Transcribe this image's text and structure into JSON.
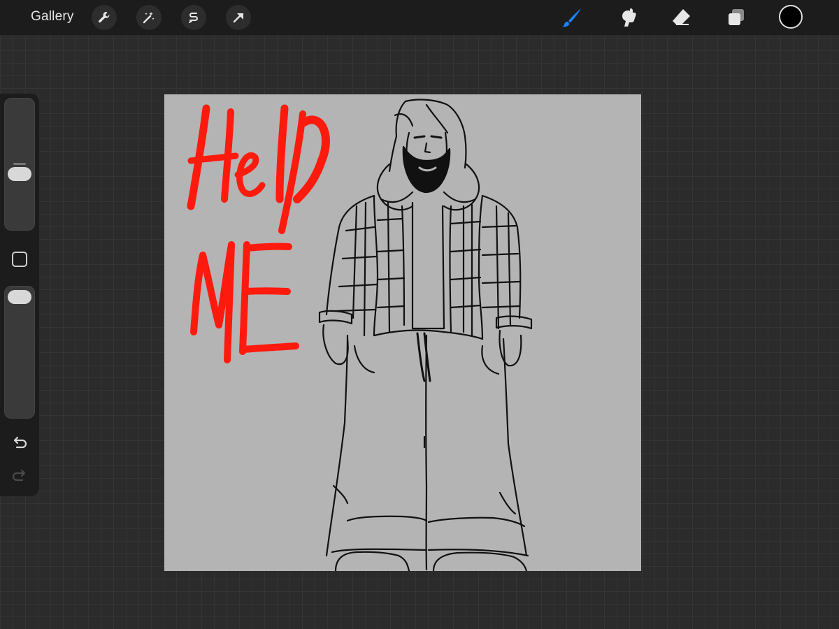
{
  "toolbar": {
    "gallery_label": "Gallery",
    "actions": [
      {
        "name": "actions-wrench-icon"
      },
      {
        "name": "adjustments-wand-icon"
      },
      {
        "name": "selection-s-icon"
      },
      {
        "name": "transform-arrow-icon"
      }
    ],
    "tools": [
      "brush-icon",
      "smudge-icon",
      "eraser-icon",
      "layers-icon"
    ],
    "active_tool": "brush",
    "active_color": "#000000",
    "accent_color": "#1a82ff"
  },
  "sidebar": {
    "brush_size_level": 0.55,
    "opacity_level": 0.95,
    "undo_enabled": true,
    "redo_enabled": false
  },
  "canvas": {
    "background": "#b4b4b4",
    "handwritten_text": "Help ME",
    "text_color": "#ff1a0e"
  }
}
